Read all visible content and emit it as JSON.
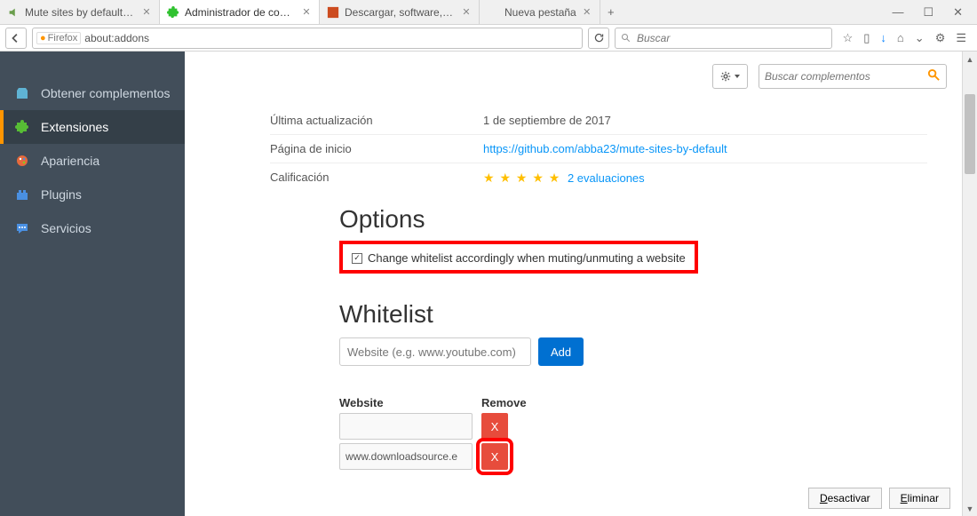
{
  "window": {
    "tabs": [
      {
        "label": "Mute sites by default :: C…"
      },
      {
        "label": "Administrador de complem…"
      },
      {
        "label": "Descargar, software, control…"
      },
      {
        "label": "Nueva pestaña"
      }
    ],
    "url_identity": "Firefox",
    "url": "about:addons",
    "search_placeholder": "Buscar"
  },
  "sidebar": {
    "items": [
      {
        "label": "Obtener complementos"
      },
      {
        "label": "Extensiones"
      },
      {
        "label": "Apariencia"
      },
      {
        "label": "Plugins"
      },
      {
        "label": "Servicios"
      }
    ]
  },
  "header": {
    "addon_search_placeholder": "Buscar complementos"
  },
  "meta": {
    "last_update_label": "Última actualización",
    "last_update_value": "1 de septiembre de 2017",
    "homepage_label": "Página de inicio",
    "homepage_url": "https://github.com/abba23/mute-sites-by-default",
    "rating_label": "Calificación",
    "rating_reviews": "2 evaluaciones"
  },
  "options": {
    "title": "Options",
    "checkbox_label": "Change whitelist accordingly when muting/unmuting a website"
  },
  "whitelist": {
    "title": "Whitelist",
    "input_placeholder": "Website (e.g. www.youtube.com)",
    "add_label": "Add",
    "col_website": "Website",
    "col_remove": "Remove",
    "rows": [
      {
        "site": ""
      },
      {
        "site": "www.downloadsource.e"
      }
    ],
    "remove_symbol": "X"
  },
  "footer": {
    "disable": "Desactivar",
    "remove": "Eliminar"
  }
}
